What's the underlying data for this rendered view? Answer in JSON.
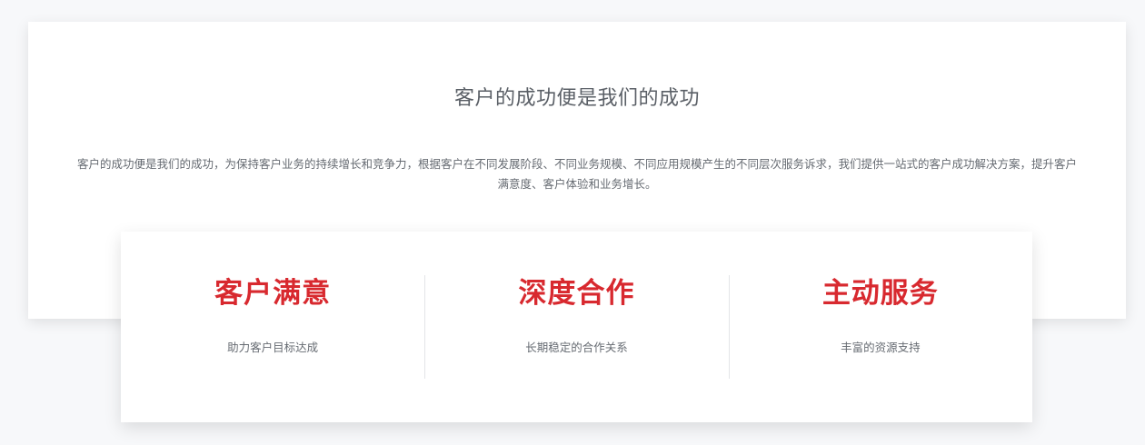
{
  "section": {
    "title": "客户的成功便是我们的成功",
    "description": "客户的成功便是我们的成功，为保持客户业务的持续增长和竞争力，根据客户在不同发展阶段、不同业务规模、不同应用规模产生的不同层次服务诉求，我们提供一站式的客户成功解决方案，提升客户满意度、客户体验和业务增长。"
  },
  "features": [
    {
      "title": "客户满意",
      "subtitle": "助力客户目标达成"
    },
    {
      "title": "深度合作",
      "subtitle": "长期稳定的合作关系"
    },
    {
      "title": "主动服务",
      "subtitle": "丰富的资源支持"
    }
  ],
  "colors": {
    "accent": "#d8292f",
    "text": "#666b72",
    "title": "#5a5f66",
    "background": "#f7f8fa"
  }
}
